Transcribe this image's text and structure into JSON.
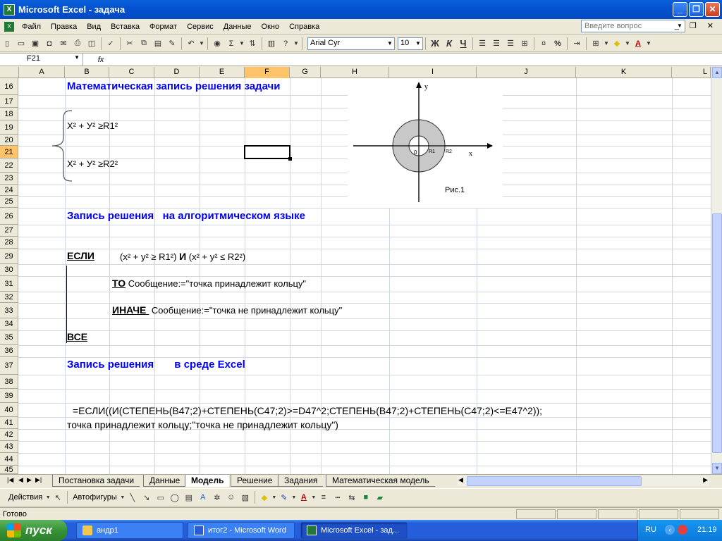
{
  "window": {
    "title": "Microsoft Excel - задача"
  },
  "menu": {
    "items": [
      "Файл",
      "Правка",
      "Вид",
      "Вставка",
      "Формат",
      "Сервис",
      "Данные",
      "Окно",
      "Справка"
    ],
    "help_placeholder": "Введите вопрос"
  },
  "toolbar": {
    "font": "Arial Cyr",
    "size": "10",
    "bold": "Ж",
    "italic": "К",
    "underline": "Ч",
    "percent": "%"
  },
  "formula_bar": {
    "name_box": "F21",
    "fx": "fx",
    "content": ""
  },
  "columns": [
    "A",
    "B",
    "C",
    "D",
    "E",
    "F",
    "G",
    "H",
    "I",
    "J",
    "K",
    "L"
  ],
  "rows": [
    "16",
    "17",
    "18",
    "19",
    "20",
    "21",
    "22",
    "23",
    "24",
    "25",
    "26",
    "27",
    "28",
    "29",
    "30",
    "31",
    "32",
    "33",
    "34",
    "35",
    "36",
    "37",
    "38",
    "39",
    "40",
    "41",
    "42",
    "43",
    "44",
    "45"
  ],
  "selected": {
    "cell": "F21",
    "col": "F",
    "row": "21"
  },
  "cells": {
    "heading1": "Математическая запись решения задачи",
    "eq1": "X² + У² ≥R1²",
    "eq2": "X² + У² ≥R2²",
    "heading2": "Запись решения   на алгоритмическом языке",
    "if_kw": "ЕСЛИ",
    "if_cond1": "(x² + y² ≥ R1²) ",
    "if_and": "И",
    "if_cond2": " (x² + y² ≤ R2²)",
    "then_kw": "ТО",
    "then_text": " Сообщение:=\"точка принадлежит кольцу\"",
    "else_kw": "ИНАЧЕ ",
    "else_text": " Сообщение:=\"точка не принадлежит кольцу\"",
    "end_kw": "ВСЕ",
    "heading3": "Запись решения       в среде Excel",
    "formula_line1": "=ЕСЛИ((И(СТЕПЕНЬ(B47;2)+СТЕПЕНЬ(C47;2)>=D47^2;СТЕПЕНЬ(B47;2)+СТЕПЕНЬ(C47;2)<=E47^2));",
    "formula_line2": "точка принадлежит кольцу;\"точка не принадлежит кольцу\")"
  },
  "figure": {
    "y_label": "y",
    "x_label": "x",
    "origin": "0",
    "r1": "R1",
    "r2": "R2",
    "caption": "Рис.1",
    "ring_color": "#c8c8c8"
  },
  "sheets": {
    "tabs": [
      "Постановка задачи",
      "Данные",
      "Модель",
      "Решение",
      "Задания",
      "Математическая модель"
    ],
    "active": "Модель"
  },
  "drawing": {
    "actions": "Действия",
    "autoshapes": "Автофигуры"
  },
  "status": {
    "text": "Готово"
  },
  "taskbar": {
    "start": "пуск",
    "tasks": [
      "андр1",
      "итог2 - Microsoft Word",
      "Microsoft Excel - зад..."
    ],
    "lang": "RU",
    "clock": "21:19"
  },
  "colors": {
    "heading": "#0000ff",
    "selection_header": "#ffc36a"
  }
}
